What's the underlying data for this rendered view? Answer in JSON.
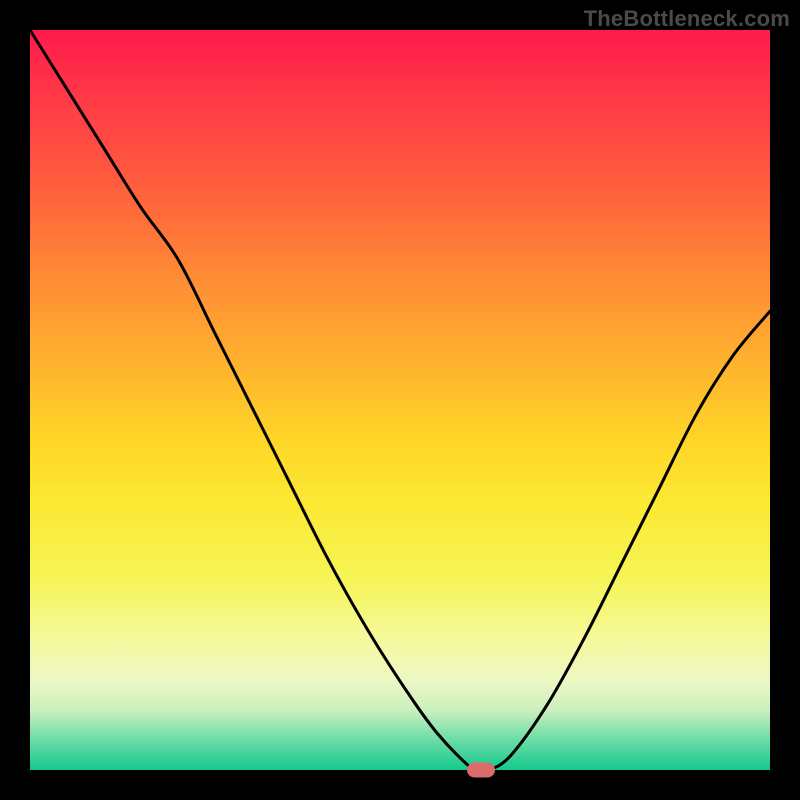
{
  "watermark": "TheBottleneck.com",
  "chart_data": {
    "type": "line",
    "title": "",
    "xlabel": "",
    "ylabel": "",
    "xlim": [
      0,
      100
    ],
    "ylim": [
      0,
      100
    ],
    "x": [
      0,
      5,
      10,
      15,
      20,
      25,
      30,
      35,
      40,
      45,
      50,
      55,
      60,
      62,
      65,
      70,
      75,
      80,
      85,
      90,
      95,
      100
    ],
    "y": [
      100,
      92,
      84,
      76,
      69,
      59,
      49,
      39,
      29,
      20,
      12,
      5,
      0,
      0,
      2,
      9,
      18,
      28,
      38,
      48,
      56,
      62
    ],
    "marker": {
      "x": 61,
      "y": 0
    },
    "gradient_bands": [
      {
        "color": "#ff1a4b",
        "stop": 0
      },
      {
        "color": "#ffd427",
        "stop": 55
      },
      {
        "color": "#f6f99a",
        "stop": 82
      },
      {
        "color": "#14c98b",
        "stop": 100
      }
    ]
  }
}
